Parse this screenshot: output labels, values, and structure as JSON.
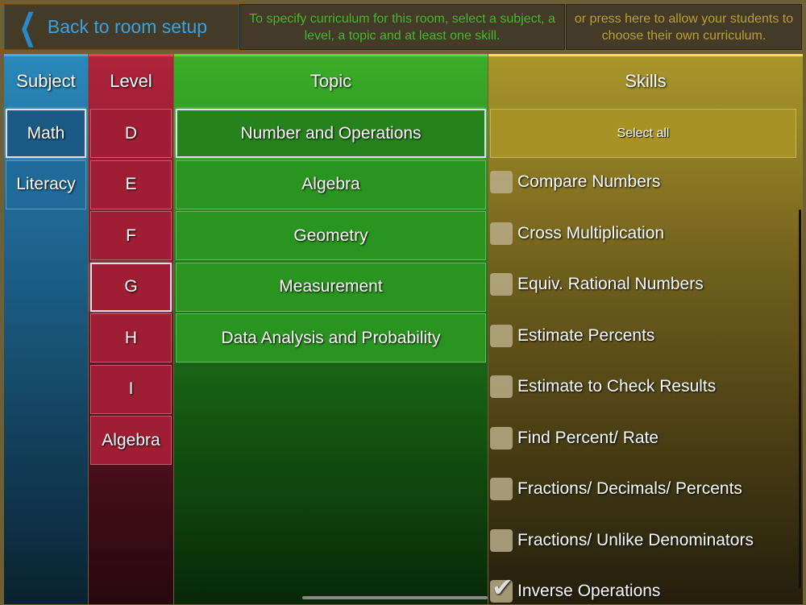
{
  "top_bar": {
    "back_label": "Back to room setup",
    "instructions": "To specify curriculum for this room, select a subject, a level, a topic and at least one skill.",
    "own_curriculum": "or press here to allow your students to choose their own curriculum."
  },
  "subject": {
    "header": "Subject",
    "items": [
      {
        "label": "Math",
        "selected": true
      },
      {
        "label": "Literacy",
        "selected": false
      }
    ]
  },
  "level": {
    "header": "Level",
    "items": [
      {
        "label": "D",
        "selected": false
      },
      {
        "label": "E",
        "selected": false
      },
      {
        "label": "F",
        "selected": false
      },
      {
        "label": "G",
        "selected": true
      },
      {
        "label": "H",
        "selected": false
      },
      {
        "label": "I",
        "selected": false
      },
      {
        "label": "Algebra",
        "selected": false
      }
    ]
  },
  "topic": {
    "header": "Topic",
    "items": [
      {
        "label": "Number and Operations",
        "selected": true
      },
      {
        "label": "Algebra",
        "selected": false
      },
      {
        "label": "Geometry",
        "selected": false
      },
      {
        "label": "Measurement",
        "selected": false
      },
      {
        "label": "Data Analysis and Probability",
        "selected": false
      }
    ]
  },
  "skills": {
    "header": "Skills",
    "select_all": "Select all",
    "items": [
      {
        "label": "Compare Numbers",
        "checked": false
      },
      {
        "label": "Cross Multiplication",
        "checked": false
      },
      {
        "label": "Equiv. Rational Numbers",
        "checked": false
      },
      {
        "label": "Estimate Percents",
        "checked": false
      },
      {
        "label": "Estimate to Check Results",
        "checked": false
      },
      {
        "label": "Find Percent/ Rate",
        "checked": false
      },
      {
        "label": "Fractions/ Decimals/ Percents",
        "checked": false
      },
      {
        "label": "Fractions/ Unlike Denominators",
        "checked": false
      },
      {
        "label": "Inverse Operations",
        "checked": true
      }
    ]
  }
}
